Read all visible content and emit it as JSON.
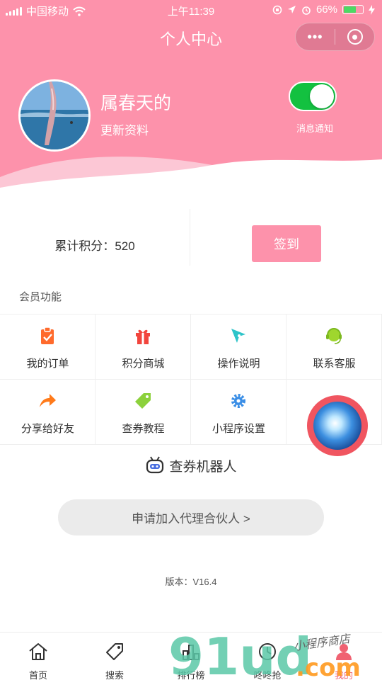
{
  "status_bar": {
    "carrier": "中国移动",
    "time": "上午11:39",
    "battery_percent": "66%",
    "battery_level": 0.66
  },
  "nav": {
    "title": "个人中心",
    "more_icon": "ellipsis-icon",
    "close_icon": "target-icon"
  },
  "profile": {
    "username": "属春天的",
    "edit_label": "更新资料",
    "notify_label": "消息通知",
    "notify_on": true
  },
  "points": {
    "label": "累计积分：",
    "value": "520",
    "signin_label": "签到"
  },
  "member": {
    "section_title": "会员功能",
    "items": [
      {
        "label": "我的订单",
        "icon": "clipboard-check-icon",
        "color": "#ff6a2c"
      },
      {
        "label": "积分商城",
        "icon": "gift-icon",
        "color": "#f2453d"
      },
      {
        "label": "操作说明",
        "icon": "compass-icon",
        "color": "#2ec4c9"
      },
      {
        "label": "联系客服",
        "icon": "headset-icon",
        "color": "#9fd62e"
      },
      {
        "label": "分享给好友",
        "icon": "share-arrow-icon",
        "color": "#ff7a1a"
      },
      {
        "label": "查券教程",
        "icon": "tag-icon",
        "color": "#8cd13c"
      },
      {
        "label": "小程序设置",
        "icon": "gear-icon",
        "color": "#3a8ee6"
      }
    ]
  },
  "robot": {
    "label": "查券机器人",
    "icon": "robot-icon"
  },
  "partner": {
    "label": "申请加入代理合伙人 >"
  },
  "version": "版本：V16.4",
  "tabbar": {
    "items": [
      {
        "label": "首页",
        "icon": "home-icon"
      },
      {
        "label": "搜索",
        "icon": "tag-search-icon"
      },
      {
        "label": "排行榜",
        "icon": "ranking-icon"
      },
      {
        "label": "咚咚抢",
        "icon": "clock-icon"
      },
      {
        "label": "我的",
        "icon": "user-icon"
      }
    ],
    "active_index": 4
  },
  "watermark": {
    "logo_text": "91ud",
    "domain_text": ".com",
    "slogan": "小程序商店"
  },
  "colors": {
    "brand_pink": "#fd92ab",
    "toggle_green": "#13c140",
    "active_tab": "#f06272",
    "float_button_ring": "#f05560"
  }
}
